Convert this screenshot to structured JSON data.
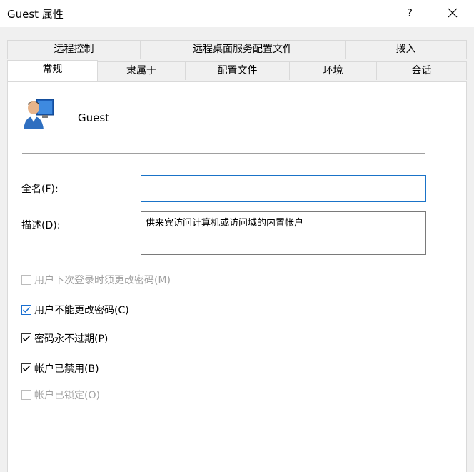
{
  "window": {
    "title": "Guest 属性",
    "help": "?",
    "close": "✕"
  },
  "tabs_top": [
    "远程控制",
    "远程桌面服务配置文件",
    "拨入"
  ],
  "tabs_bottom": [
    "常规",
    "隶属于",
    "配置文件",
    "环境",
    "会话"
  ],
  "active_tab": "常规",
  "user": {
    "name": "Guest"
  },
  "fields": {
    "fullname_label": "全名(F):",
    "fullname_value": "",
    "description_label": "描述(D):",
    "description_value": "供来宾访问计算机或访问域的内置帐户"
  },
  "checkboxes": [
    {
      "label": "用户下次登录时须更改密码(M)",
      "checked": false,
      "disabled": true
    },
    {
      "label": "用户不能更改密码(C)",
      "checked": true,
      "disabled": false
    },
    {
      "label": "密码永不过期(P)",
      "checked": true,
      "disabled": false
    },
    {
      "label": "帐户已禁用(B)",
      "checked": true,
      "disabled": false
    },
    {
      "label": "帐户已锁定(O)",
      "checked": false,
      "disabled": true
    }
  ],
  "colors": {
    "focus_border": "#1a73c8",
    "check_blue": "#1a6fd0",
    "disabled_text": "#a0a0a0"
  }
}
